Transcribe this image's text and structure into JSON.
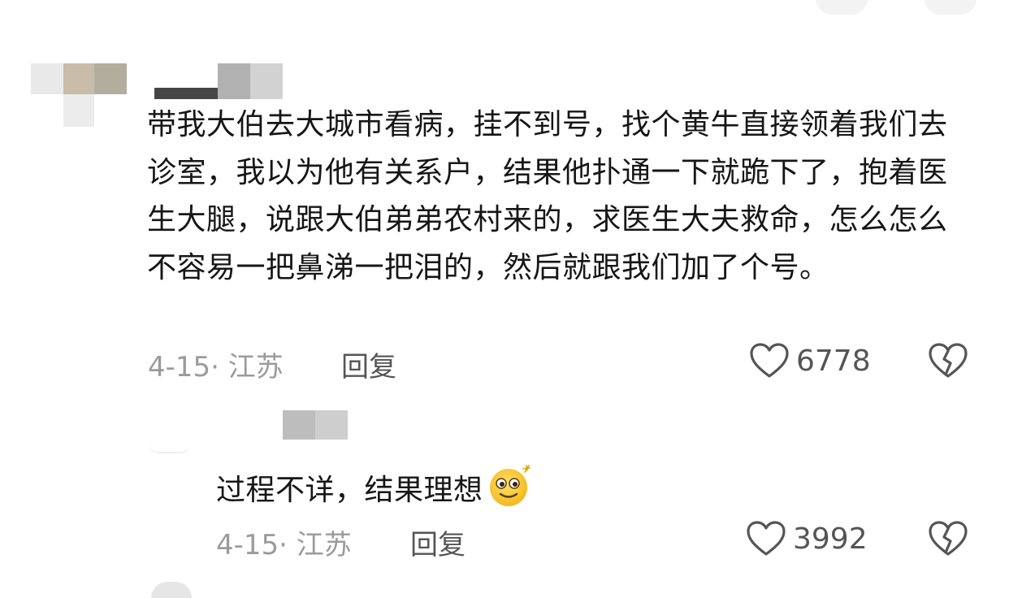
{
  "comments": [
    {
      "text": "带我大伯去大城市看病，挂不到号，找个黄牛直接领着我们去诊室，我以为他有关系户，结果他扑通一下就跪下了，抱着医生大腿，说跟大伯弟弟农村来的，求医生大夫救命，怎么怎么不容易一把鼻涕一把泪的，然后就跟我们加了个号。",
      "date": "4-15",
      "location": "· 江苏",
      "reply_label": "回复",
      "likes": "6778"
    },
    {
      "text": "过程不详，结果理想",
      "emoji": "smiling-face-emoji",
      "date": "4-15",
      "location": "· 江苏",
      "reply_label": "回复",
      "likes": "3992"
    }
  ],
  "icons": {
    "like": "heart-outline-icon",
    "dislike": "broken-heart-icon"
  },
  "colors": {
    "text": "#161616",
    "meta": "#9b9b9b",
    "action": "#555555"
  }
}
